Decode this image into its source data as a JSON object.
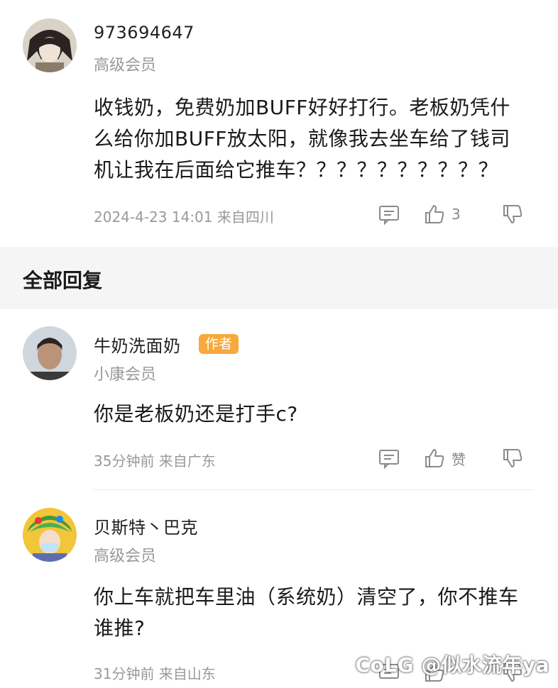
{
  "post": {
    "username": "973694647",
    "member_level": "高级会员",
    "content": "收钱奶，免费奶加BUFF好好打行。老板奶凭什么给你加BUFF放太阳，就像我去坐车给了钱司机让我在后面给它推车？？？？？？？？？？",
    "meta": "2024-4-23 14:01 来自四川",
    "like_count": "3"
  },
  "section": {
    "title": "全部回复"
  },
  "replies": [
    {
      "username": "牛奶洗面奶",
      "badge": "作者",
      "member_level": "小康会员",
      "content": "你是老板奶还是打手c?",
      "meta": "35分钟前 来自广东",
      "like_label": "赞"
    },
    {
      "username": "贝斯特丶巴克",
      "member_level": "高级会员",
      "content": "你上车就把车里油（系统奶）清空了，你不推车谁推?",
      "meta": "31分钟前 来自山东"
    }
  ],
  "watermark": "CoLG @似水流年ya",
  "icons": {
    "reply": "comment-icon",
    "like": "thumbs-up-icon",
    "dislike": "thumbs-down-icon"
  },
  "colors": {
    "badge": "#f7a93b",
    "meta": "#999999",
    "section_bg": "#f5f5f5"
  }
}
